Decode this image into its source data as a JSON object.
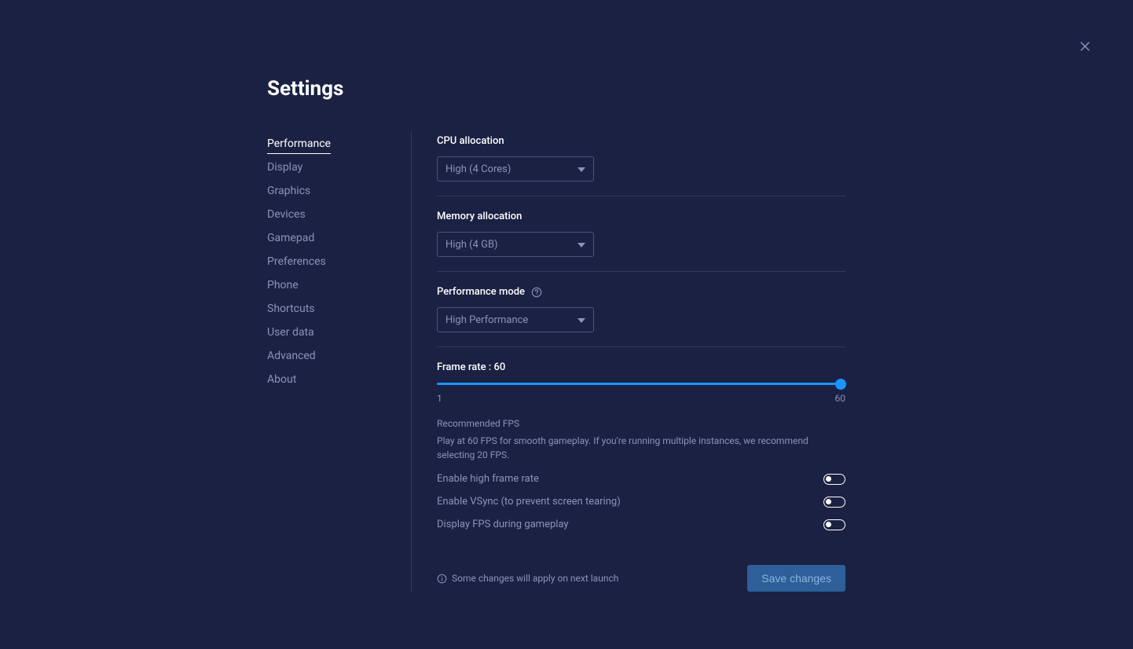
{
  "title": "Settings",
  "sidebar": {
    "items": [
      {
        "label": "Performance",
        "active": true
      },
      {
        "label": "Display",
        "active": false
      },
      {
        "label": "Graphics",
        "active": false
      },
      {
        "label": "Devices",
        "active": false
      },
      {
        "label": "Gamepad",
        "active": false
      },
      {
        "label": "Preferences",
        "active": false
      },
      {
        "label": "Phone",
        "active": false
      },
      {
        "label": "Shortcuts",
        "active": false
      },
      {
        "label": "User data",
        "active": false
      },
      {
        "label": "Advanced",
        "active": false
      },
      {
        "label": "About",
        "active": false
      }
    ]
  },
  "cpu": {
    "label": "CPU allocation",
    "value": "High (4 Cores)"
  },
  "memory": {
    "label": "Memory allocation",
    "value": "High (4 GB)"
  },
  "perf_mode": {
    "label": "Performance mode",
    "value": "High Performance"
  },
  "frame_rate": {
    "label": "Frame rate : 60",
    "min_label": "1",
    "max_label": "60",
    "value": 60,
    "recommended_title": "Recommended FPS",
    "recommended_desc": "Play at 60 FPS for smooth gameplay. If you're running multiple instances, we recommend selecting 20 FPS."
  },
  "toggles": {
    "high_frame": {
      "label": "Enable high frame rate",
      "on": false
    },
    "vsync": {
      "label": "Enable VSync (to prevent screen tearing)",
      "on": false
    },
    "display_fps": {
      "label": "Display FPS during gameplay",
      "on": false
    }
  },
  "footer": {
    "note": "Some changes will apply on next launch",
    "save_label": "Save changes"
  }
}
